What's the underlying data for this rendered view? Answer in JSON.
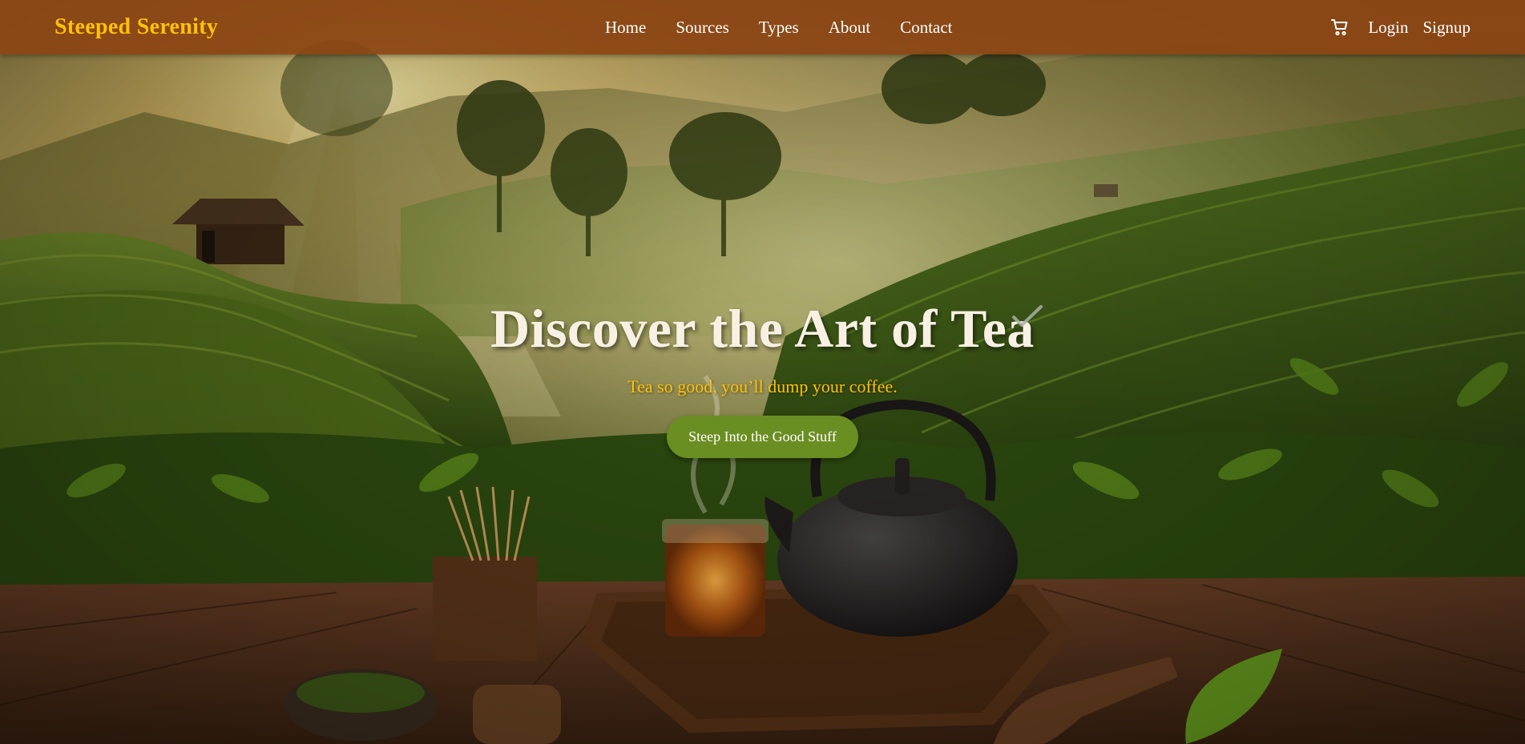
{
  "navbar": {
    "brand": "Steeped Serenity",
    "links": [
      "Home",
      "Sources",
      "Types",
      "About",
      "Contact"
    ],
    "cart_icon": "cart-icon",
    "login": "Login",
    "signup": "Signup"
  },
  "hero": {
    "title": "Discover the Art of Tea",
    "subtitle": "Tea so good, you’ll dump your coffee.",
    "button": "Steep Into the Good Stuff"
  },
  "colors": {
    "navbar": "#8B4513",
    "brand": "#FFC107",
    "subtitle": "#FFC107",
    "button": "#6B8E23",
    "title": "#F8F1E3"
  }
}
